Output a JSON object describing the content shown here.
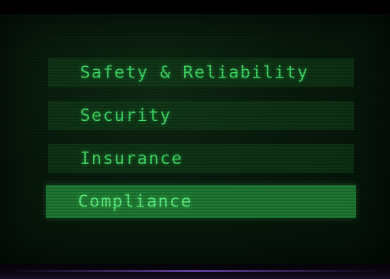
{
  "menu": {
    "items": [
      {
        "label": "Safety & Reliability",
        "selected": false
      },
      {
        "label": "Security",
        "selected": false
      },
      {
        "label": "Insurance",
        "selected": false
      },
      {
        "label": "Compliance",
        "selected": true
      }
    ]
  },
  "colors": {
    "text": "#3ddc64",
    "item_background": "#12461e",
    "selected_background": "#1f7a33",
    "screen_background": "#081a0c"
  }
}
